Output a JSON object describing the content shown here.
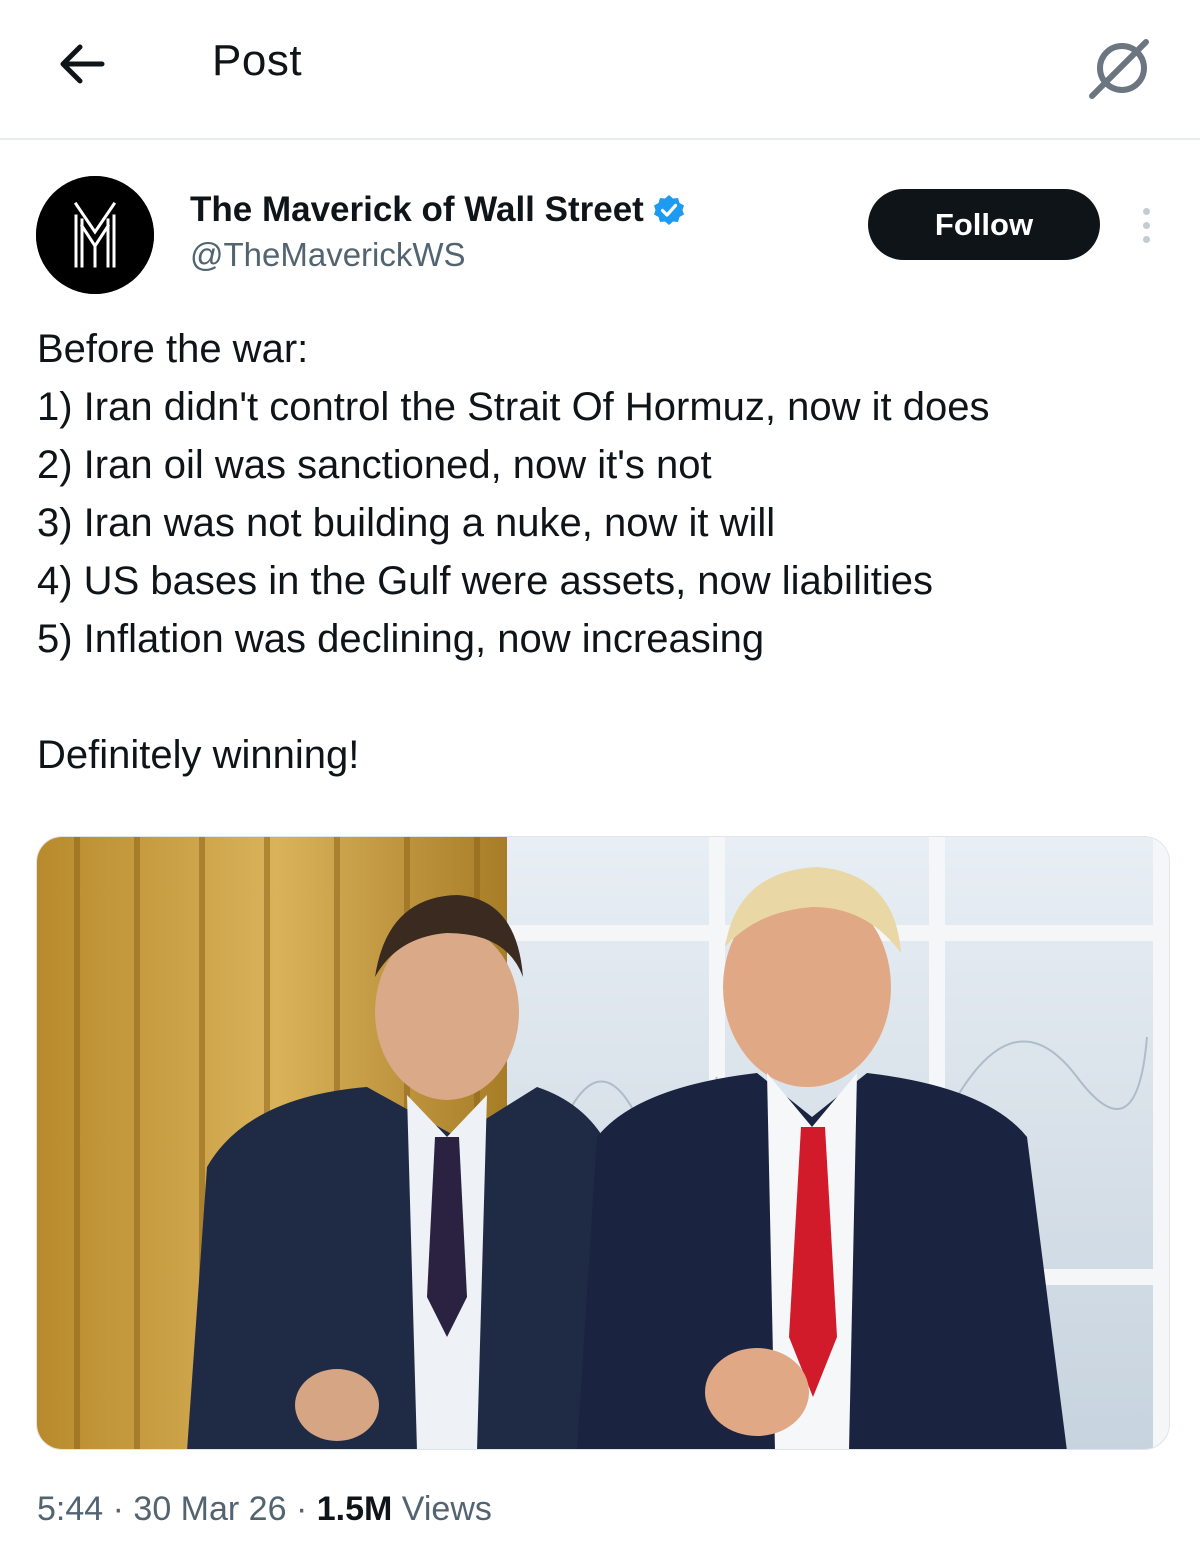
{
  "header": {
    "title": "Post"
  },
  "author": {
    "display_name": "The Maverick of Wall Street",
    "handle": "@TheMaverickWS",
    "verified": true,
    "avatar_letter": "M",
    "follow_label": "Follow"
  },
  "tweet": {
    "lines": [
      "Before the war:",
      "1) Iran didn't control the Strait Of Hormuz, now it does",
      "2) Iran oil was sanctioned, now it's not",
      "3) Iran was not building a nuke, now it will",
      "4) US bases in the Gulf were assets, now liabilities",
      "5) Inflation was declining, now increasing"
    ],
    "closing": "Definitely winning!"
  },
  "meta": {
    "time": "5:44",
    "date": "30 Mar 26",
    "views_count": "1.5M",
    "views_label": "Views",
    "separator": "·"
  },
  "colors": {
    "text": "#0f1419",
    "secondary": "#536471",
    "verified": "#1d9bf0",
    "follow_bg": "#0f1419",
    "divider": "#e6ecf0"
  }
}
